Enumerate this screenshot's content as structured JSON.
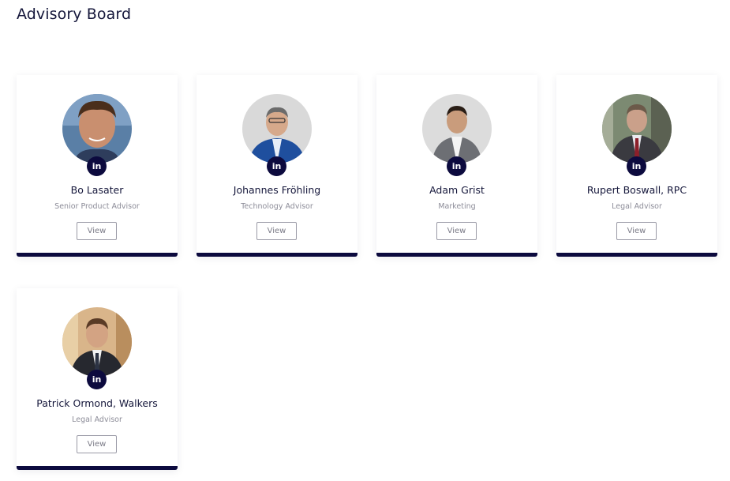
{
  "page": {
    "title": "Advisory Board"
  },
  "advisors": [
    {
      "name": "Bo Lasater",
      "role": "Senior Product Advisor",
      "view_label": "View",
      "linkedin_label": "in"
    },
    {
      "name": "Johannes Fröhling",
      "role": "Technology Advisor",
      "view_label": "View",
      "linkedin_label": "in"
    },
    {
      "name": "Adam Grist",
      "role": "Marketing",
      "view_label": "View",
      "linkedin_label": "in"
    },
    {
      "name": "Rupert Boswall, RPC",
      "role": "Legal Advisor",
      "view_label": "View",
      "linkedin_label": "in"
    },
    {
      "name": "Patrick Ormond, Walkers",
      "role": "Legal Advisor",
      "view_label": "View",
      "linkedin_label": "in"
    }
  ],
  "colors": {
    "accent": "#0c0a3e",
    "card_bg": "#ffffff",
    "muted_text": "#8c8c98"
  },
  "icons": {
    "social": "linkedin-icon"
  }
}
